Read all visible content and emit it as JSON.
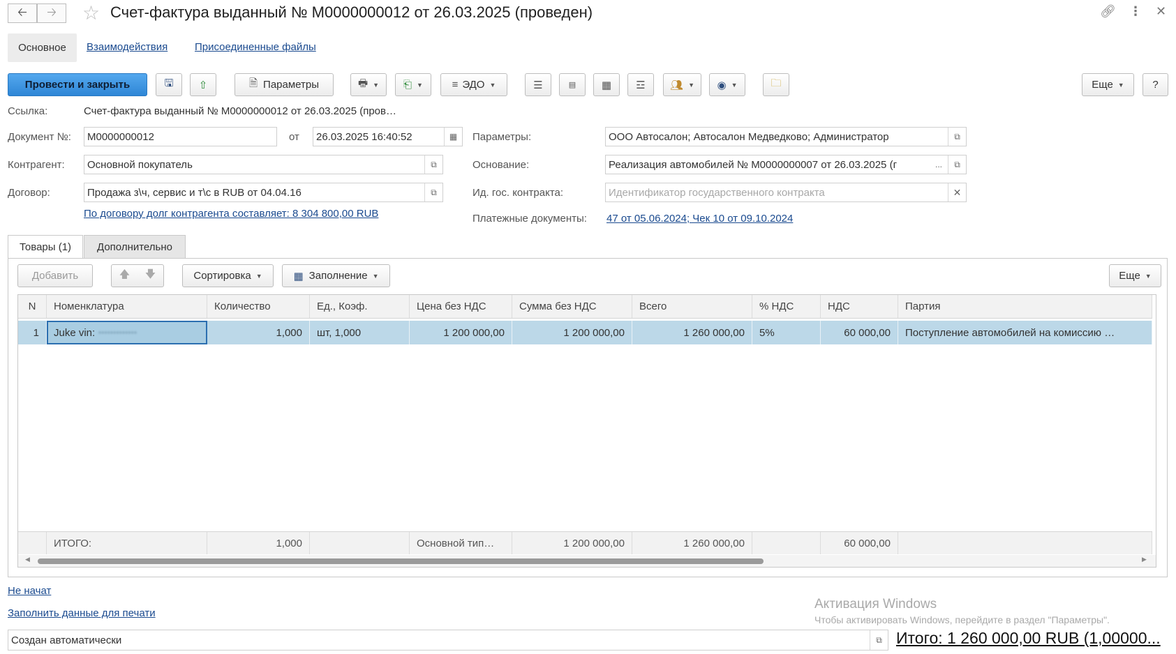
{
  "window": {
    "title": "Счет-фактура выданный № М0000000012 от 26.03.2025 (проведен)"
  },
  "form_tabs": [
    {
      "label": "Основное"
    },
    {
      "label": "Взаимодействия"
    },
    {
      "label": "Присоединенные файлы"
    }
  ],
  "toolbar": {
    "post_close": "Провести и закрыть",
    "params": "Параметры",
    "edo": "ЭДО",
    "more": "Еще",
    "help": "?"
  },
  "fields": {
    "link_label": "Ссылка:",
    "link_value": "Счет-фактура выданный № М0000000012 от 26.03.2025 (пров…",
    "doc_no_label": "Документ №:",
    "doc_no": "М0000000012",
    "from_label": "от",
    "date": "26.03.2025 16:40:52",
    "counterparty_label": "Контрагент:",
    "counterparty": "Основной покупатель",
    "contract_label": "Договор:",
    "contract": "Продажа з\\ч, сервис и т\\с в RUB от 04.04.16",
    "debt_link": "По договору долг контрагента составляет: 8 304 800,00 RUB",
    "params_label": "Параметры:",
    "params": "ООО Автосалон; Автосалон Медведково; Администратор",
    "basis_label": "Основание:",
    "basis": "Реализация автомобилей № М0000000007 от 26.03.2025 (г",
    "basis_more": "...",
    "gov_contract_label": "Ид. гос. контракта:",
    "gov_contract_placeholder": "Идентификатор государственного контракта",
    "payment_docs_label": "Платежные документы:",
    "payment_docs": "47 от 05.06.2024; Чек 10 от 09.10.2024"
  },
  "inner_tabs": [
    {
      "label": "Товары (1)"
    },
    {
      "label": "Дополнительно"
    }
  ],
  "table_toolbar": {
    "add": "Добавить",
    "sort": "Сортировка",
    "fill": "Заполнение",
    "more": "Еще"
  },
  "table": {
    "columns": [
      "N",
      "Номенклатура",
      "Количество",
      "Ед., Коэф.",
      "Цена без НДС",
      "Сумма без НДС",
      "Всего",
      "% НДС",
      "НДС",
      "Партия"
    ],
    "rows": [
      {
        "n": "1",
        "item": "Juke vin: ",
        "item_masked": "•••••••••••••",
        "qty": "1,000",
        "unit": "шт, 1,000",
        "price": "1 200 000,00",
        "sum": "1 200 000,00",
        "total": "1 260 000,00",
        "vat_rate": "5%",
        "vat": "60 000,00",
        "batch": "Поступление автомобилей на комиссию …"
      }
    ],
    "footer": {
      "label": "ИТОГО:",
      "qty": "1,000",
      "price": "Основной тип…",
      "sum": "1 200 000,00",
      "total": "1 260 000,00",
      "vat": "60 000,00"
    }
  },
  "bottom": {
    "status_link": "Не начат",
    "print_link": "Заполнить данные для печати",
    "comment": "Создан автоматически",
    "total": "Итого: 1 260 000,00 RUB (1,00000..."
  },
  "watermark": {
    "line1": "Активация Windows",
    "line2": "Чтобы активировать Windows, перейдите в раздел \"Параметры\"."
  },
  "colors": {
    "accent": "#2e86d6",
    "link": "#1a4a8f",
    "selected_row": "#bcd8e8"
  }
}
